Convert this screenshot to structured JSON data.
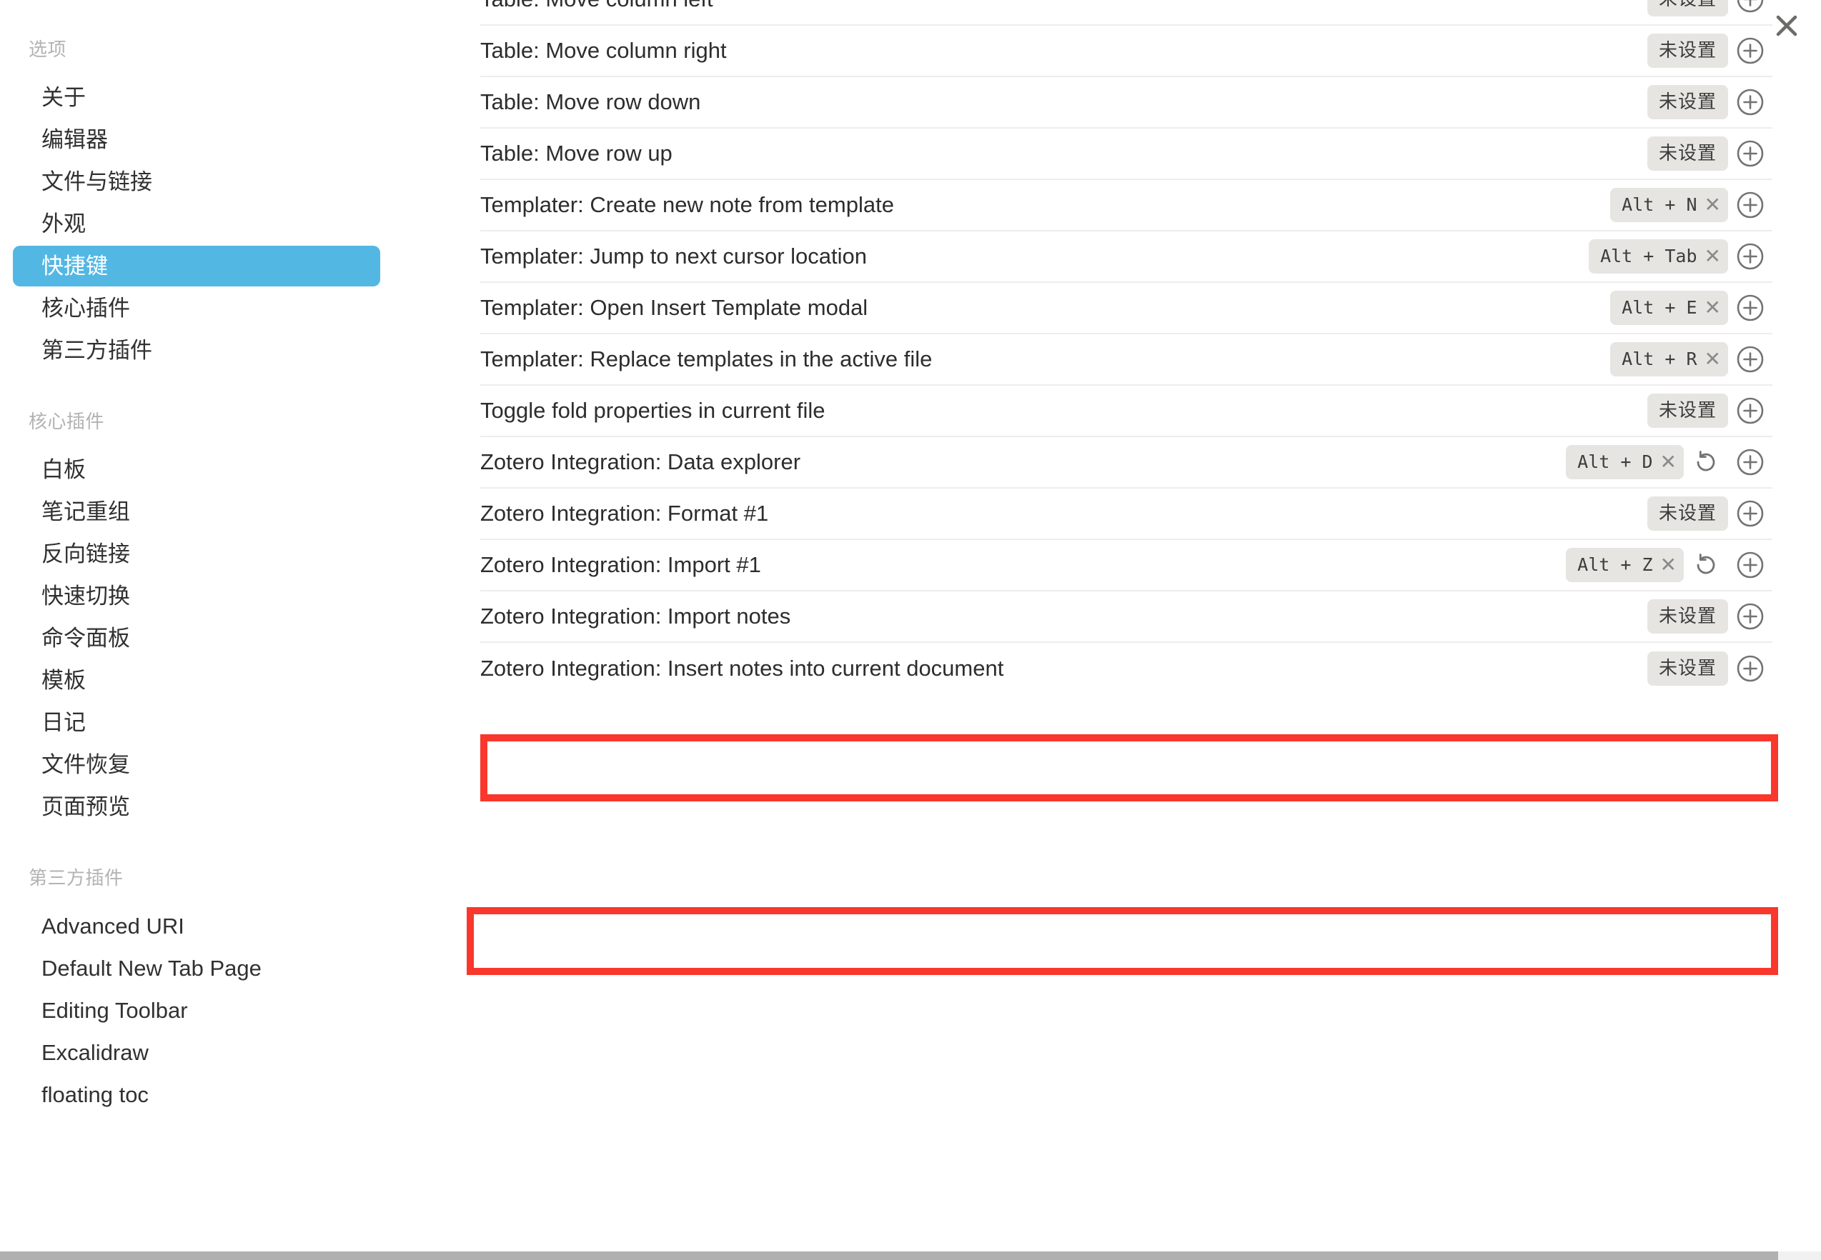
{
  "window": {
    "close_label": "×"
  },
  "sidebar": {
    "sections": [
      {
        "heading": "选项",
        "items": [
          {
            "label": "关于",
            "active": false
          },
          {
            "label": "编辑器",
            "active": false
          },
          {
            "label": "文件与链接",
            "active": false
          },
          {
            "label": "外观",
            "active": false
          },
          {
            "label": "快捷键",
            "active": true
          },
          {
            "label": "核心插件",
            "active": false
          },
          {
            "label": "第三方插件",
            "active": false
          }
        ]
      },
      {
        "heading": "核心插件",
        "items": [
          {
            "label": "白板",
            "active": false
          },
          {
            "label": "笔记重组",
            "active": false
          },
          {
            "label": "反向链接",
            "active": false
          },
          {
            "label": "快速切换",
            "active": false
          },
          {
            "label": "命令面板",
            "active": false
          },
          {
            "label": "模板",
            "active": false
          },
          {
            "label": "日记",
            "active": false
          },
          {
            "label": "文件恢复",
            "active": false
          },
          {
            "label": "页面预览",
            "active": false
          }
        ]
      },
      {
        "heading": "第三方插件",
        "items": [
          {
            "label": "Advanced URI",
            "active": false
          },
          {
            "label": "Default New Tab Page",
            "active": false
          },
          {
            "label": "Editing Toolbar",
            "active": false
          },
          {
            "label": "Excalidraw",
            "active": false
          },
          {
            "label": "floating toc",
            "active": false
          }
        ]
      }
    ]
  },
  "hotkeys": {
    "unset_label": "未设置",
    "rows": [
      {
        "command": "Table: Move column left",
        "hotkey": null,
        "unset": "未设置",
        "has_restore": false,
        "highlighted": false
      },
      {
        "command": "Table: Move column right",
        "hotkey": null,
        "unset": "未设置",
        "has_restore": false,
        "highlighted": false
      },
      {
        "command": "Table: Move row down",
        "hotkey": null,
        "unset": "未设置",
        "has_restore": false,
        "highlighted": false
      },
      {
        "command": "Table: Move row up",
        "hotkey": null,
        "unset": "未设置",
        "has_restore": false,
        "highlighted": false
      },
      {
        "command": "Templater: Create new note from template",
        "hotkey": "Alt + N",
        "unset": null,
        "has_restore": false,
        "highlighted": false
      },
      {
        "command": "Templater: Jump to next cursor location",
        "hotkey": "Alt + Tab",
        "unset": null,
        "has_restore": false,
        "highlighted": false
      },
      {
        "command": "Templater: Open Insert Template modal",
        "hotkey": "Alt + E",
        "unset": null,
        "has_restore": false,
        "highlighted": false
      },
      {
        "command": "Templater: Replace templates in the active file",
        "hotkey": "Alt + R",
        "unset": null,
        "has_restore": false,
        "highlighted": false
      },
      {
        "command": "Toggle fold properties in current file",
        "hotkey": null,
        "unset": "未设置",
        "has_restore": false,
        "highlighted": false
      },
      {
        "command": "Zotero Integration: Data explorer",
        "hotkey": "Alt + D",
        "unset": null,
        "has_restore": true,
        "highlighted": true
      },
      {
        "command": "Zotero Integration: Format #1",
        "hotkey": null,
        "unset": "未设置",
        "has_restore": false,
        "highlighted": false
      },
      {
        "command": "Zotero Integration: Import #1",
        "hotkey": "Alt + Z",
        "unset": null,
        "has_restore": true,
        "highlighted": true
      },
      {
        "command": "Zotero Integration: Import notes",
        "hotkey": null,
        "unset": "未设置",
        "has_restore": false,
        "highlighted": false
      },
      {
        "command": "Zotero Integration: Insert notes into current document",
        "hotkey": null,
        "unset": "未设置",
        "has_restore": false,
        "highlighted": false
      }
    ]
  },
  "colors": {
    "accent": "#53b7e4",
    "badge_bg": "#e7e5e1",
    "annotation_red": "#f9372c",
    "divider": "#ededed",
    "text": "#2d2d2d",
    "muted": "#b3b3b3"
  }
}
